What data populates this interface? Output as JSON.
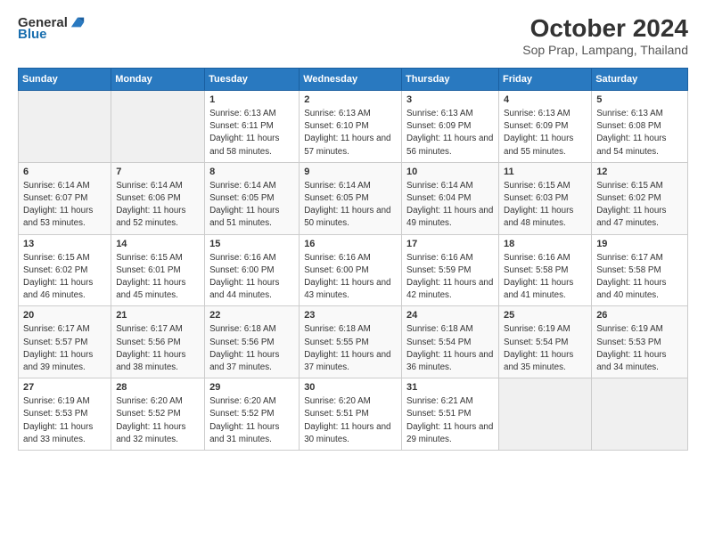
{
  "logo": {
    "text_general": "General",
    "text_blue": "Blue"
  },
  "title": "October 2024",
  "subtitle": "Sop Prap, Lampang, Thailand",
  "days_of_week": [
    "Sunday",
    "Monday",
    "Tuesday",
    "Wednesday",
    "Thursday",
    "Friday",
    "Saturday"
  ],
  "weeks": [
    [
      {
        "day": "",
        "empty": true
      },
      {
        "day": "",
        "empty": true
      },
      {
        "day": "1",
        "sunrise": "6:13 AM",
        "sunset": "6:11 PM",
        "daylight": "11 hours and 58 minutes."
      },
      {
        "day": "2",
        "sunrise": "6:13 AM",
        "sunset": "6:10 PM",
        "daylight": "11 hours and 57 minutes."
      },
      {
        "day": "3",
        "sunrise": "6:13 AM",
        "sunset": "6:09 PM",
        "daylight": "11 hours and 56 minutes."
      },
      {
        "day": "4",
        "sunrise": "6:13 AM",
        "sunset": "6:09 PM",
        "daylight": "11 hours and 55 minutes."
      },
      {
        "day": "5",
        "sunrise": "6:13 AM",
        "sunset": "6:08 PM",
        "daylight": "11 hours and 54 minutes."
      }
    ],
    [
      {
        "day": "6",
        "sunrise": "6:14 AM",
        "sunset": "6:07 PM",
        "daylight": "11 hours and 53 minutes."
      },
      {
        "day": "7",
        "sunrise": "6:14 AM",
        "sunset": "6:06 PM",
        "daylight": "11 hours and 52 minutes."
      },
      {
        "day": "8",
        "sunrise": "6:14 AM",
        "sunset": "6:05 PM",
        "daylight": "11 hours and 51 minutes."
      },
      {
        "day": "9",
        "sunrise": "6:14 AM",
        "sunset": "6:05 PM",
        "daylight": "11 hours and 50 minutes."
      },
      {
        "day": "10",
        "sunrise": "6:14 AM",
        "sunset": "6:04 PM",
        "daylight": "11 hours and 49 minutes."
      },
      {
        "day": "11",
        "sunrise": "6:15 AM",
        "sunset": "6:03 PM",
        "daylight": "11 hours and 48 minutes."
      },
      {
        "day": "12",
        "sunrise": "6:15 AM",
        "sunset": "6:02 PM",
        "daylight": "11 hours and 47 minutes."
      }
    ],
    [
      {
        "day": "13",
        "sunrise": "6:15 AM",
        "sunset": "6:02 PM",
        "daylight": "11 hours and 46 minutes."
      },
      {
        "day": "14",
        "sunrise": "6:15 AM",
        "sunset": "6:01 PM",
        "daylight": "11 hours and 45 minutes."
      },
      {
        "day": "15",
        "sunrise": "6:16 AM",
        "sunset": "6:00 PM",
        "daylight": "11 hours and 44 minutes."
      },
      {
        "day": "16",
        "sunrise": "6:16 AM",
        "sunset": "6:00 PM",
        "daylight": "11 hours and 43 minutes."
      },
      {
        "day": "17",
        "sunrise": "6:16 AM",
        "sunset": "5:59 PM",
        "daylight": "11 hours and 42 minutes."
      },
      {
        "day": "18",
        "sunrise": "6:16 AM",
        "sunset": "5:58 PM",
        "daylight": "11 hours and 41 minutes."
      },
      {
        "day": "19",
        "sunrise": "6:17 AM",
        "sunset": "5:58 PM",
        "daylight": "11 hours and 40 minutes."
      }
    ],
    [
      {
        "day": "20",
        "sunrise": "6:17 AM",
        "sunset": "5:57 PM",
        "daylight": "11 hours and 39 minutes."
      },
      {
        "day": "21",
        "sunrise": "6:17 AM",
        "sunset": "5:56 PM",
        "daylight": "11 hours and 38 minutes."
      },
      {
        "day": "22",
        "sunrise": "6:18 AM",
        "sunset": "5:56 PM",
        "daylight": "11 hours and 37 minutes."
      },
      {
        "day": "23",
        "sunrise": "6:18 AM",
        "sunset": "5:55 PM",
        "daylight": "11 hours and 37 minutes."
      },
      {
        "day": "24",
        "sunrise": "6:18 AM",
        "sunset": "5:54 PM",
        "daylight": "11 hours and 36 minutes."
      },
      {
        "day": "25",
        "sunrise": "6:19 AM",
        "sunset": "5:54 PM",
        "daylight": "11 hours and 35 minutes."
      },
      {
        "day": "26",
        "sunrise": "6:19 AM",
        "sunset": "5:53 PM",
        "daylight": "11 hours and 34 minutes."
      }
    ],
    [
      {
        "day": "27",
        "sunrise": "6:19 AM",
        "sunset": "5:53 PM",
        "daylight": "11 hours and 33 minutes."
      },
      {
        "day": "28",
        "sunrise": "6:20 AM",
        "sunset": "5:52 PM",
        "daylight": "11 hours and 32 minutes."
      },
      {
        "day": "29",
        "sunrise": "6:20 AM",
        "sunset": "5:52 PM",
        "daylight": "11 hours and 31 minutes."
      },
      {
        "day": "30",
        "sunrise": "6:20 AM",
        "sunset": "5:51 PM",
        "daylight": "11 hours and 30 minutes."
      },
      {
        "day": "31",
        "sunrise": "6:21 AM",
        "sunset": "5:51 PM",
        "daylight": "11 hours and 29 minutes."
      },
      {
        "day": "",
        "empty": true
      },
      {
        "day": "",
        "empty": true
      }
    ]
  ]
}
